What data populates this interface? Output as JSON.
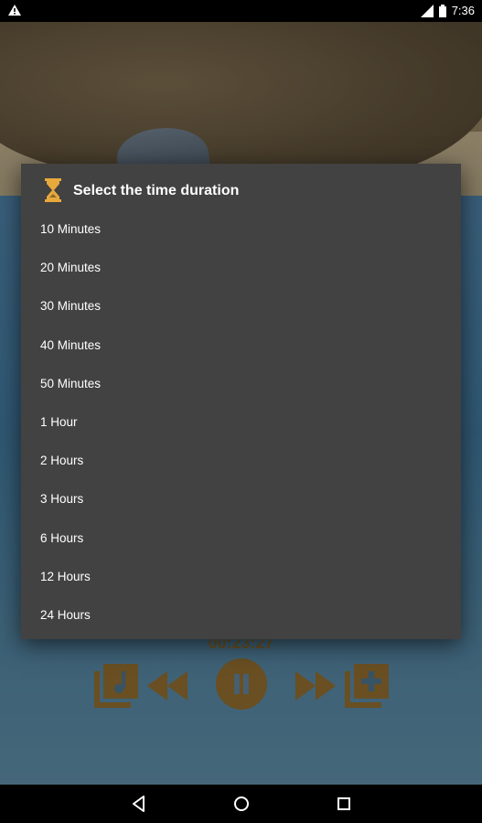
{
  "status_bar": {
    "clock": "7:36",
    "icons": [
      "warning-icon",
      "signal-icon",
      "battery-icon"
    ]
  },
  "player": {
    "elapsed_time": "00:23:27"
  },
  "dialog": {
    "icon": "hourglass-icon",
    "title": "Select the time duration",
    "options": [
      "10 Minutes",
      "20 Minutes",
      "30 Minutes",
      "40 Minutes",
      "50 Minutes",
      "1 Hour",
      "2 Hours",
      "3 Hours",
      "6 Hours",
      "12 Hours",
      "24 Hours"
    ]
  },
  "colors": {
    "dialog_bg": "#424242",
    "accent": "#e8a93c",
    "player_controls": "#8c6a2e"
  },
  "navigation": {
    "icons": [
      "back-icon",
      "home-icon",
      "recent-apps-icon"
    ]
  }
}
